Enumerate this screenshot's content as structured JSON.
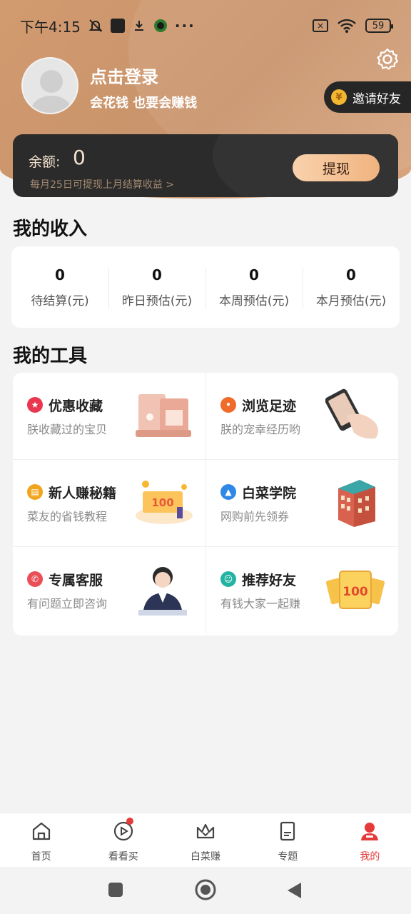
{
  "status_bar": {
    "time": "下午4:15",
    "more": "···",
    "battery": "59"
  },
  "header": {
    "login_title": "点击登录",
    "login_subtitle": "会花钱 也要会赚钱",
    "invite_label": "邀请好友",
    "coin_symbol": "¥"
  },
  "balance": {
    "label": "余额:",
    "value": "0",
    "note": "每月25日可提现上月结算收益 >",
    "withdraw_label": "提现"
  },
  "income": {
    "title": "我的收入",
    "items": [
      {
        "value": "0",
        "label": "待结算(元)"
      },
      {
        "value": "0",
        "label": "昨日预估(元)"
      },
      {
        "value": "0",
        "label": "本周预估(元)"
      },
      {
        "value": "0",
        "label": "本月预估(元)"
      }
    ]
  },
  "tools": {
    "title": "我的工具",
    "items": [
      {
        "title": "优惠收藏",
        "subtitle": "朕收藏过的宝贝",
        "icon": "star-icon",
        "color": "#e8374e"
      },
      {
        "title": "浏览足迹",
        "subtitle": "朕的宠幸经历哟",
        "icon": "footprint-icon",
        "color": "#f06a2a"
      },
      {
        "title": "新人赚秘籍",
        "subtitle": "菜友的省钱教程",
        "icon": "book-icon",
        "color": "#f0a51c"
      },
      {
        "title": "白菜学院",
        "subtitle": "网购前先领券",
        "icon": "graduation-cap-icon",
        "color": "#2f88e6"
      },
      {
        "title": "专属客服",
        "subtitle": "有问题立即咨询",
        "icon": "phone-icon",
        "color": "#ea4f58"
      },
      {
        "title": "推荐好友",
        "subtitle": "有钱大家一起赚",
        "icon": "user-icon",
        "color": "#22b3a2"
      }
    ]
  },
  "nav": {
    "items": [
      {
        "label": "首页",
        "icon": "home-icon"
      },
      {
        "label": "看看买",
        "icon": "play-icon"
      },
      {
        "label": "白菜赚",
        "icon": "crown-icon"
      },
      {
        "label": "专题",
        "icon": "document-icon"
      },
      {
        "label": "我的",
        "icon": "profile-icon"
      }
    ],
    "active_color": "#e53a3a"
  },
  "art": {
    "voucher_text": "100"
  }
}
